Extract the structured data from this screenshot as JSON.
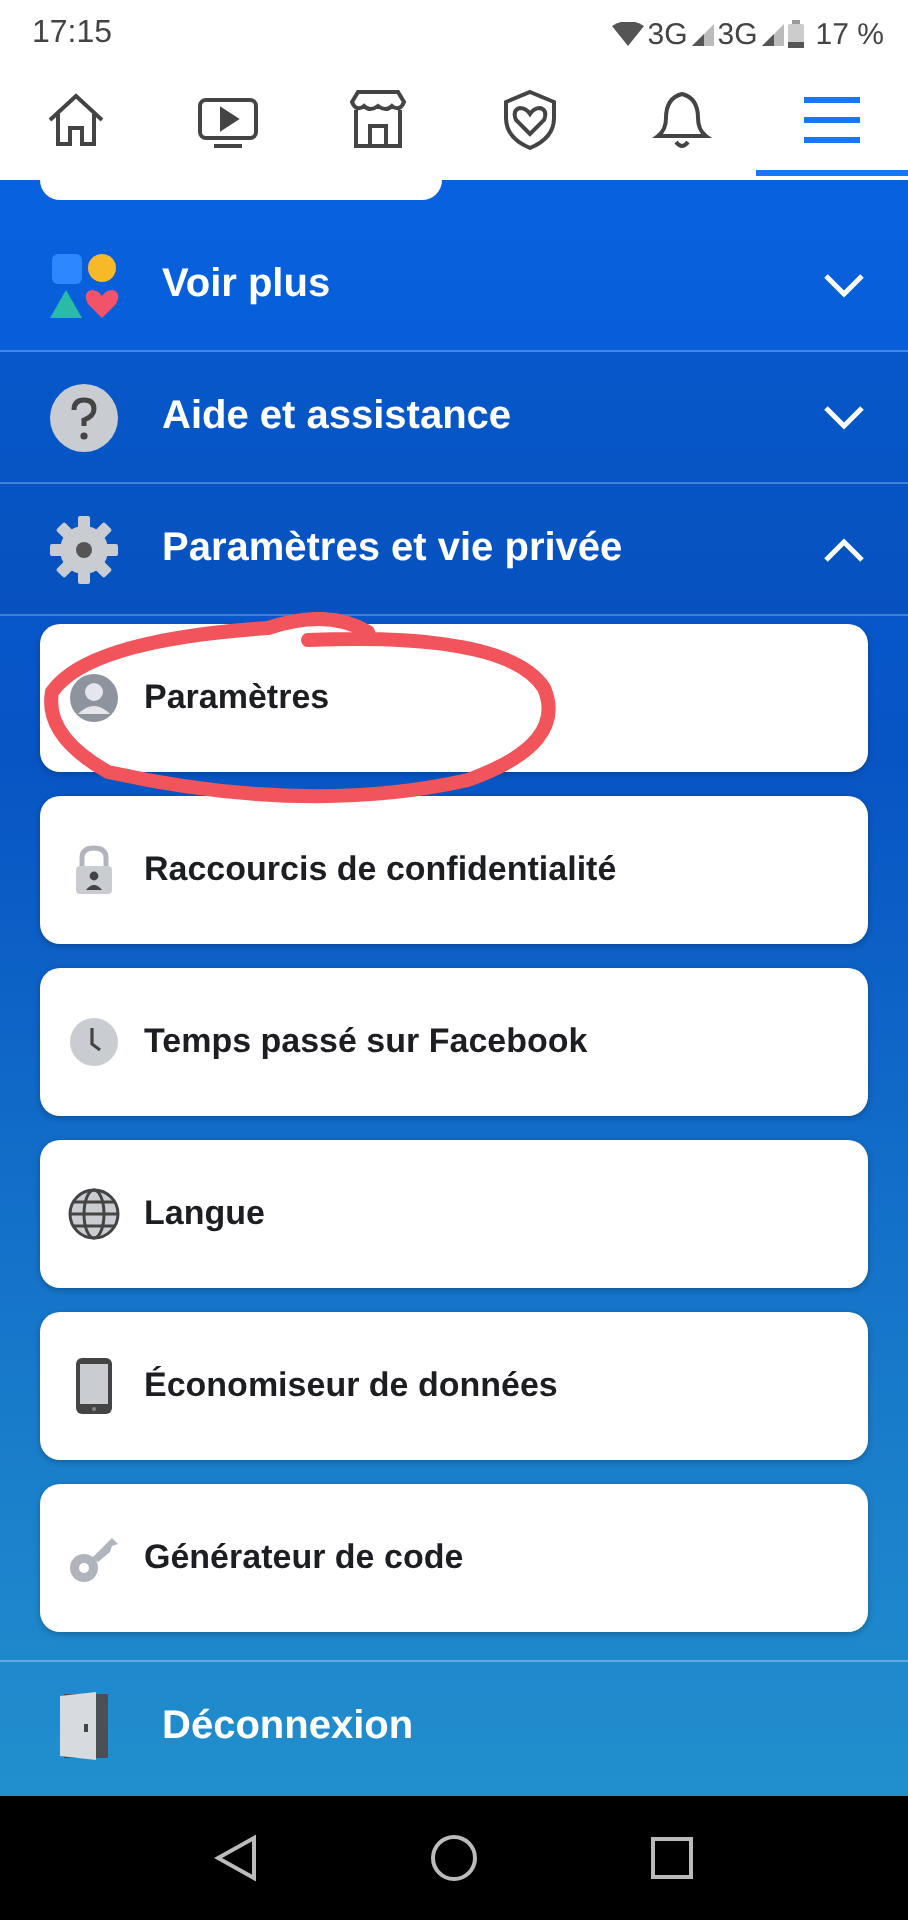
{
  "status_bar": {
    "time": "17:15",
    "networks": [
      "3G",
      "3G"
    ],
    "battery": "17 %"
  },
  "tabs": [
    {
      "selected": false
    },
    {
      "selected": false
    },
    {
      "selected": false
    },
    {
      "selected": false
    },
    {
      "selected": false
    },
    {
      "selected": true
    }
  ],
  "sections": [
    {
      "label": "Voir plus",
      "expanded": false
    },
    {
      "label": "Aide et assistance",
      "expanded": false
    },
    {
      "label": "Paramètres et vie privée",
      "expanded": true
    }
  ],
  "settings_items": [
    "Paramètres",
    "Raccourcis de confidentialité",
    "Temps passé sur Facebook",
    "Langue",
    "Économiseur de données",
    "Générateur de code"
  ],
  "logout": "Déconnexion"
}
